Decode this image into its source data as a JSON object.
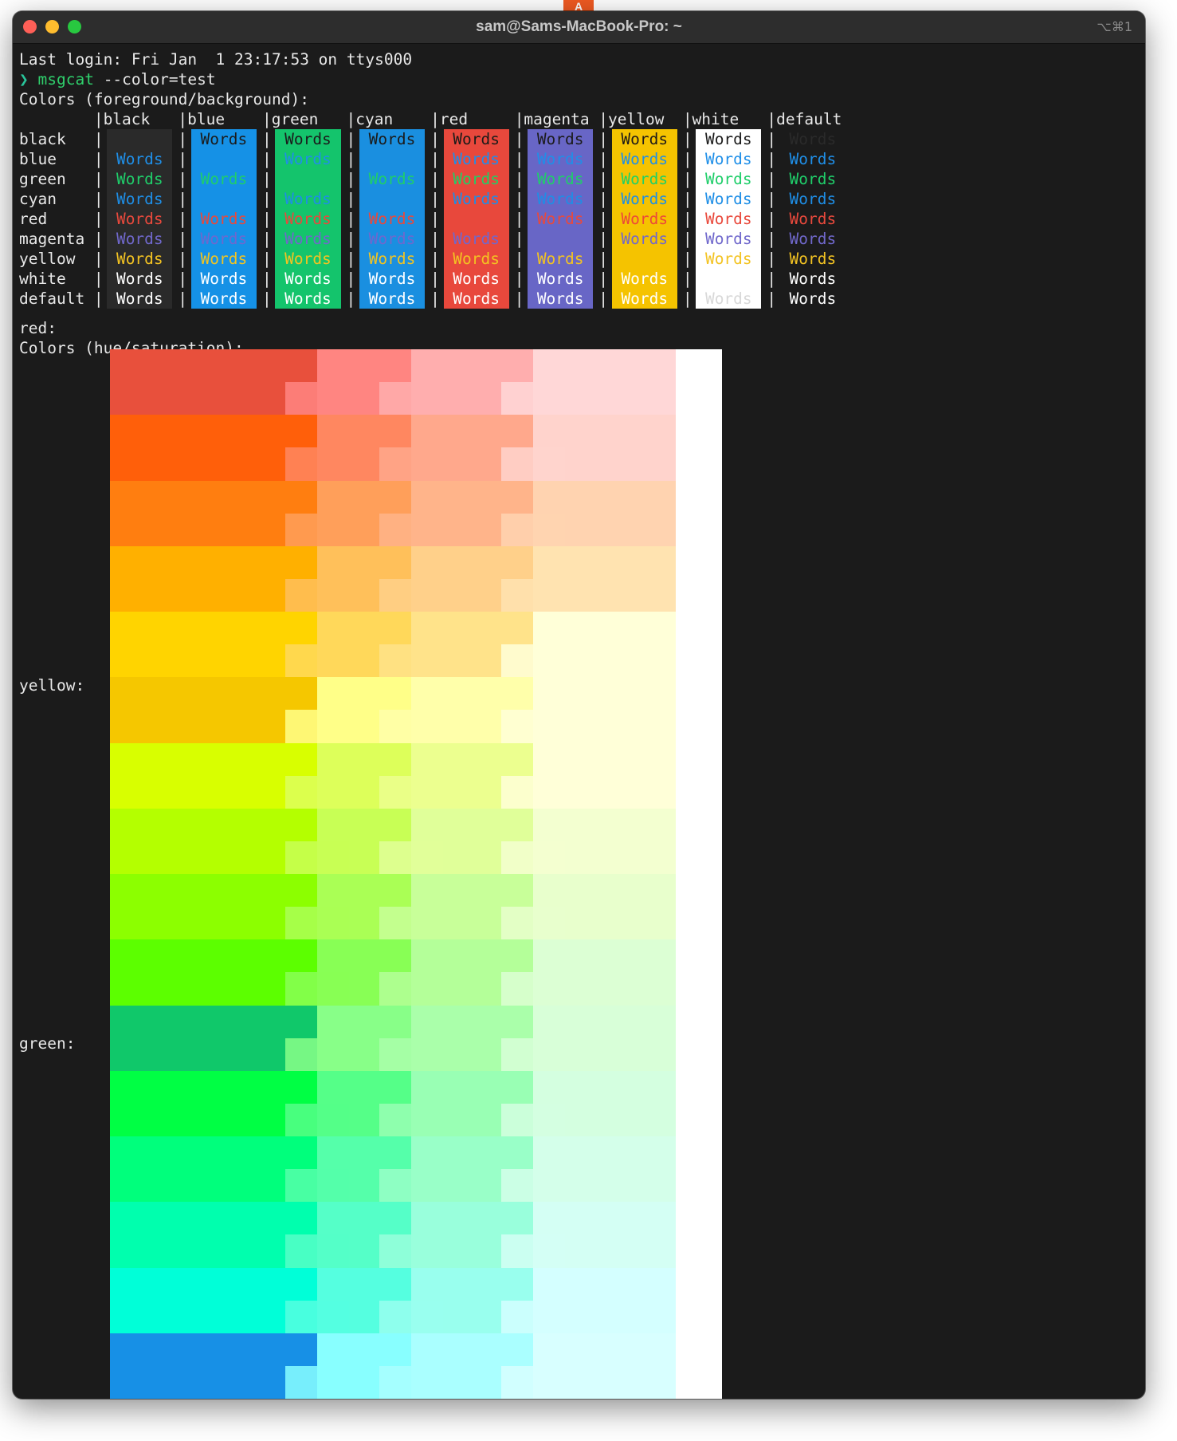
{
  "dock_badge": "A",
  "window": {
    "title": "sam@Sams-MacBook-Pro: ~",
    "shortcut": "⌥⌘1"
  },
  "terminal": {
    "last_login": "Last login: Fri Jan  1 23:17:53 on ttys000",
    "prompt_symbol": "❯",
    "command": "msgcat",
    "command_args": " --color=test",
    "section1_title": "Colors (foreground/background):",
    "section2_title": "Colors (hue/saturation):"
  },
  "color_table": {
    "columns": [
      "black",
      "blue",
      "green",
      "cyan",
      "red",
      "magenta",
      "yellow",
      "white",
      "default"
    ],
    "rows": [
      "black",
      "blue",
      "green",
      "cyan",
      "red",
      "magenta",
      "yellow",
      "white",
      "default"
    ],
    "cell_text": "Words",
    "palette": {
      "black": "#2a2a2a",
      "blue": "#1591e6",
      "green": "#14c46c",
      "cyan": "#1a8fe0",
      "red": "#e8483c",
      "magenta": "#6866c6",
      "yellow": "#f5c300",
      "white": "#ffffff",
      "default": "#1b1b1b"
    },
    "fg_palette": {
      "black": "#1b1b1b",
      "blue": "#1f8fe8",
      "green": "#1fce6a",
      "cyan": "#1e8ee6",
      "red": "#e9493c",
      "magenta": "#7068cc",
      "yellow": "#f3c322",
      "white": "#ffffff",
      "default": "#ffffff"
    }
  },
  "hue_labels": [
    "red:",
    "yellow:",
    "green:"
  ],
  "hue_bands": [
    {
      "name": "red",
      "colors": [
        "#e8503c",
        "#ff8581",
        "#ffaeae",
        "#ffd7d7"
      ]
    },
    {
      "name": "red-orange",
      "colors": [
        "#ff5f0a",
        "#ff8760",
        "#ffa88c",
        "#ffd3cc"
      ]
    },
    {
      "name": "orange",
      "colors": [
        "#ff7e10",
        "#ff9f5a",
        "#ffb48a",
        "#ffd3b0"
      ]
    },
    {
      "name": "amber",
      "colors": [
        "#ffb000",
        "#ffc05a",
        "#ffd08a",
        "#ffe3b0"
      ]
    },
    {
      "name": "gold",
      "colors": [
        "#ffd400",
        "#ffd85a",
        "#ffe38a",
        "#ffffd8"
      ]
    },
    {
      "name": "yellow",
      "colors": [
        "#f5c700",
        "#ffff88",
        "#ffffaa",
        "#ffffd8"
      ]
    },
    {
      "name": "yellow-green",
      "colors": [
        "#d8ff00",
        "#ddff5a",
        "#ecff8f",
        "#ffffd8"
      ]
    },
    {
      "name": "lime",
      "colors": [
        "#b4ff00",
        "#c8ff55",
        "#e0ff99",
        "#f3ffd0"
      ]
    },
    {
      "name": "chartreuse",
      "colors": [
        "#8cff00",
        "#aaff55",
        "#c8ff99",
        "#e8ffcc"
      ]
    },
    {
      "name": "bright-green",
      "colors": [
        "#5cff00",
        "#88ff55",
        "#b4ff99",
        "#dcffd4"
      ]
    },
    {
      "name": "green",
      "colors": [
        "#10c86a",
        "#88ff88",
        "#aaffaa",
        "#d8ffd8"
      ]
    },
    {
      "name": "spring-green",
      "colors": [
        "#00ff44",
        "#55ff88",
        "#99ffb4",
        "#d4ffe0"
      ]
    },
    {
      "name": "mint",
      "colors": [
        "#00ff7c",
        "#55ffaa",
        "#99ffc8",
        "#d4ffea"
      ]
    },
    {
      "name": "aquamarine",
      "colors": [
        "#00ffae",
        "#55ffc8",
        "#99ffdc",
        "#d4fff4"
      ]
    },
    {
      "name": "turquoise",
      "colors": [
        "#00ffd8",
        "#55ffe0",
        "#99ffee",
        "#d4ffff"
      ]
    },
    {
      "name": "cyan",
      "colors": [
        "#1790e6",
        "#88ffff",
        "#aaffff",
        "#d8ffff"
      ]
    }
  ]
}
